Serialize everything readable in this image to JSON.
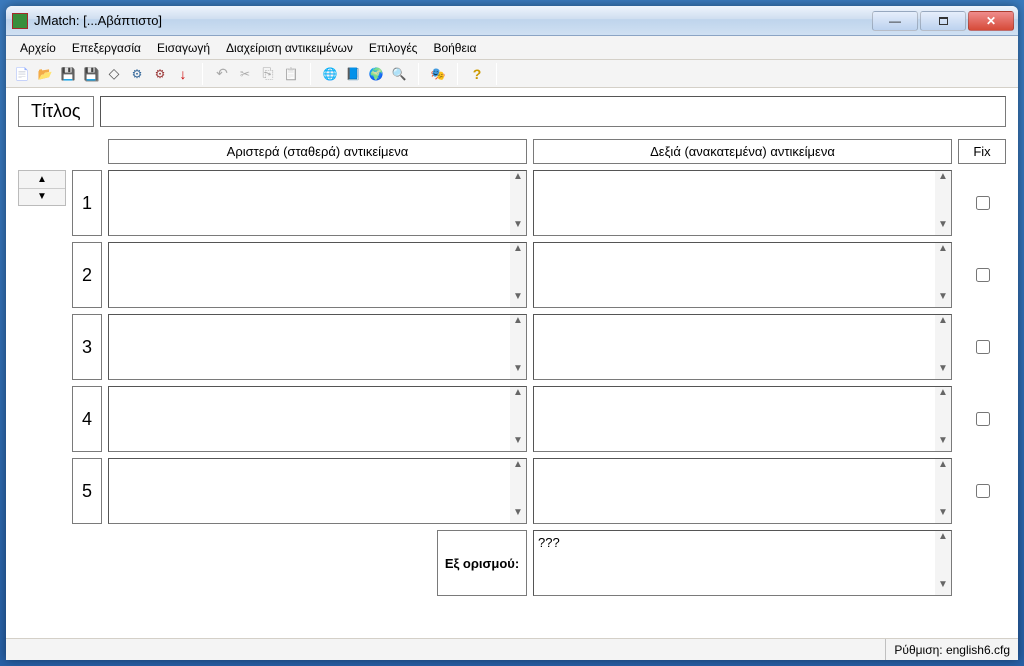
{
  "window": {
    "title": "JMatch: [...Αβάπτιστο]"
  },
  "menu": {
    "items": [
      "Αρχείο",
      "Επεξεργασία",
      "Εισαγωγή",
      "Διαχείριση αντικειμένων",
      "Επιλογές",
      "Βοήθεια"
    ]
  },
  "toolbar": {
    "icons_group1": [
      "new",
      "open",
      "save",
      "saveall",
      "erase",
      "cfg",
      "cfg2",
      "down"
    ],
    "icons_group2": [
      "undo",
      "cut",
      "copy",
      "paste"
    ],
    "icons_group3": [
      "web1",
      "web2",
      "web3",
      "web4"
    ],
    "icons_group4": [
      "mask"
    ],
    "icons_group5": [
      "help"
    ]
  },
  "labels": {
    "title_field": "Τίτλος",
    "left_column": "Αριστερά (σταθερά) αντικείμενα",
    "right_column": "Δεξιά (ανακατεμένα) αντικείμενα",
    "fix_column": "Fix",
    "default_label": "Εξ ορισμού:"
  },
  "title_value": "",
  "rows": [
    {
      "num": "1",
      "left": "",
      "right": "",
      "fix": false
    },
    {
      "num": "2",
      "left": "",
      "right": "",
      "fix": false
    },
    {
      "num": "3",
      "left": "",
      "right": "",
      "fix": false
    },
    {
      "num": "4",
      "left": "",
      "right": "",
      "fix": false
    },
    {
      "num": "5",
      "left": "",
      "right": "",
      "fix": false
    }
  ],
  "default_right_value": "???",
  "statusbar": {
    "config_text": "Ρύθμιση: english6.cfg"
  }
}
